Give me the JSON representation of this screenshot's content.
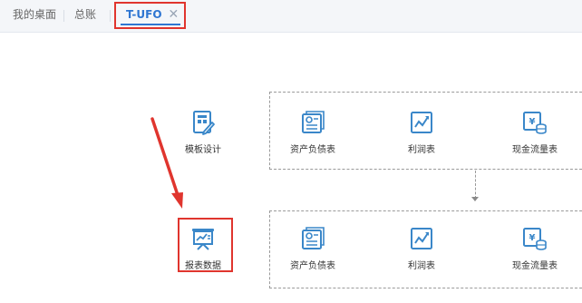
{
  "tabs": {
    "desktop_label": "我的桌面",
    "ledger_label": "总账",
    "active_label": "T-UFO",
    "close_glyph": "✕"
  },
  "tiles": {
    "template_design": "模板设计",
    "report_data": "报表数据",
    "top_row": {
      "balance_sheet": "资产负债表",
      "income_statement": "利润表",
      "cash_flow": "现金流量表"
    },
    "bottom_row": {
      "balance_sheet": "资产负债表",
      "income_statement": "利润表",
      "cash_flow": "现金流量表"
    }
  },
  "colors": {
    "accent": "#2f76d2",
    "icon": "#3a87c9",
    "annotation": "#e0352e"
  },
  "icons": {
    "template_design": "template-design-icon",
    "report_data": "presentation-board-icon",
    "balance_sheet": "certificate-document-icon",
    "income_statement": "line-chart-icon",
    "cash_flow": "cash-coins-icon",
    "close": "close-icon"
  }
}
